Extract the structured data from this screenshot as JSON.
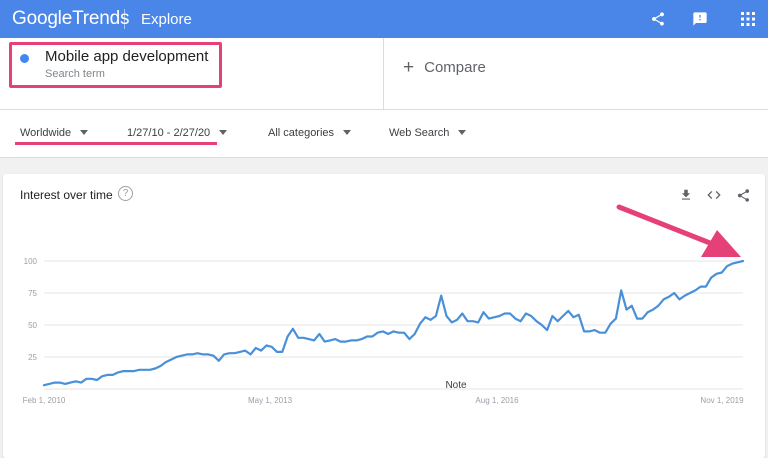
{
  "header": {
    "logo_google": "Google",
    "logo_trends": "Trends",
    "nav_label": "Explore",
    "icons": [
      "share-icon",
      "feedback-icon",
      "apps-grid-icon"
    ],
    "bar_color": "#4a86e8"
  },
  "search": {
    "term": "Mobile app development",
    "term_type": "Search term",
    "term_color": "#4285f4",
    "compare_label": "Compare"
  },
  "filters": {
    "region": "Worldwide",
    "date_range": "1/27/10 - 2/27/20",
    "category": "All categories",
    "search_type": "Web Search"
  },
  "card": {
    "title": "Interest over time",
    "help": "?",
    "icons": [
      "download-icon",
      "embed-icon",
      "share-icon"
    ],
    "note": "Note"
  },
  "annotation_color": "#e64078",
  "chart_data": {
    "type": "line",
    "title": "",
    "xlabel": "",
    "ylabel": "",
    "ylim": [
      0,
      100
    ],
    "yticks": [
      "100",
      "75",
      "50",
      "25"
    ],
    "xticks": [
      "Feb 1, 2010",
      "May 1, 2013",
      "Aug 1, 2016",
      "Nov 1, 2019"
    ],
    "grid": true,
    "line_color": "#4a90d9",
    "series": [
      {
        "values": [
          3,
          4,
          5,
          5,
          4,
          5,
          6,
          5,
          8,
          8,
          7,
          10,
          11,
          11,
          13,
          14,
          14,
          14,
          15,
          15,
          15,
          16,
          18,
          21,
          23,
          25,
          26,
          27,
          27,
          28,
          27,
          27,
          26,
          22,
          27,
          28,
          28,
          29,
          30,
          27,
          32,
          30,
          34,
          33,
          29,
          29,
          41,
          47,
          40,
          40,
          39,
          38,
          43,
          37,
          38,
          39,
          37,
          37,
          38,
          38,
          39,
          41,
          41,
          44,
          45,
          43,
          45,
          44,
          44,
          39,
          43,
          51,
          56,
          54,
          57,
          73,
          57,
          52,
          54,
          59,
          53,
          53,
          52,
          60,
          55,
          56,
          57,
          59,
          59,
          55,
          53,
          59,
          57,
          53,
          50,
          46,
          57,
          53,
          57,
          61,
          56,
          58,
          45,
          45,
          46,
          44,
          44,
          51,
          55,
          77,
          62,
          65,
          55,
          55,
          60,
          62,
          65,
          70,
          72,
          75,
          70,
          73,
          75,
          77,
          80,
          80,
          87,
          90,
          91,
          96,
          98,
          99,
          100
        ]
      }
    ]
  }
}
